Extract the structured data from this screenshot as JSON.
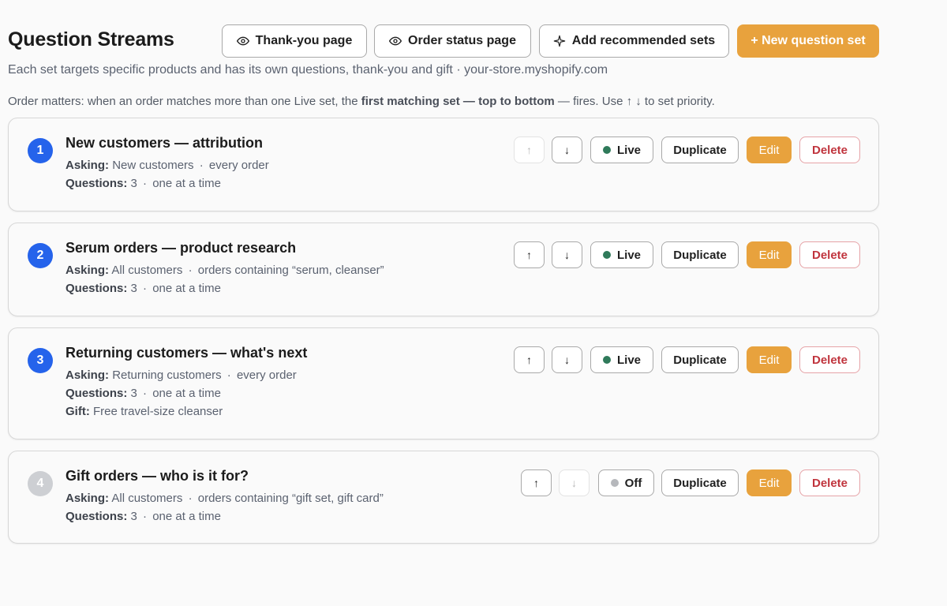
{
  "header": {
    "title": "Question Streams",
    "thank_you_label": "Thank-you page",
    "order_status_label": "Order status page",
    "add_recommended_label": "Add recommended sets",
    "new_set_label": "+ New question set"
  },
  "subtitle": "Each set targets specific products and has its own questions, thank-you and gift · your-store.myshopify.com",
  "note": {
    "pre": "Order matters: when an order matches more than one Live set, the ",
    "bold": "first matching set — top to bottom",
    "post": " — fires. Use ↑ ↓ to set priority."
  },
  "labels": {
    "asking": "Asking:",
    "questions": "Questions:",
    "gift": "Gift:",
    "dot": "·",
    "up": "↑",
    "down": "↓",
    "duplicate": "Duplicate",
    "edit": "Edit",
    "delete": "Delete"
  },
  "colors": {
    "accent": "#e8a23d",
    "number_badge": "#2563eb",
    "live_dot": "#2f7a5a",
    "off_dot": "#b6b8bc",
    "delete_text": "#c0343d"
  },
  "sets": [
    {
      "number": "1",
      "title": "New customers — attribution",
      "asking_audience": "New customers",
      "asking_scope": "every order",
      "questions_count": "3",
      "questions_mode": "one at a time",
      "status": "Live"
    },
    {
      "number": "2",
      "title": "Serum orders — product research",
      "asking_audience": "All customers",
      "asking_scope": "orders containing “serum, cleanser”",
      "questions_count": "3",
      "questions_mode": "one at a time",
      "status": "Live"
    },
    {
      "number": "3",
      "title": "Returning customers — what's next",
      "asking_audience": "Returning customers",
      "asking_scope": "every order",
      "questions_count": "3",
      "questions_mode": "one at a time",
      "gift": "Free travel-size cleanser",
      "status": "Live"
    },
    {
      "number": "4",
      "title": "Gift orders — who is it for?",
      "asking_audience": "All customers",
      "asking_scope": "orders containing “gift set, gift card”",
      "questions_count": "3",
      "questions_mode": "one at a time",
      "status": "Off"
    }
  ]
}
